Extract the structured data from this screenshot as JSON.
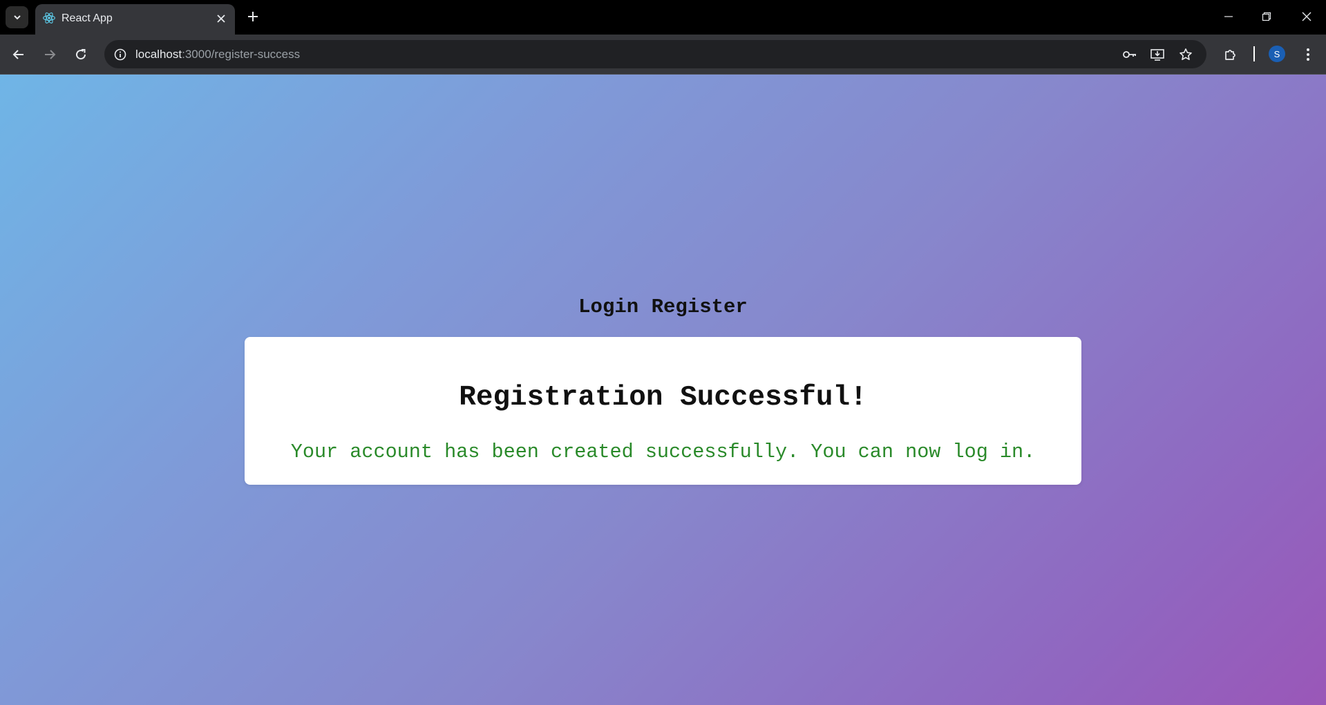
{
  "browser": {
    "tab": {
      "title": "React App",
      "favicon": "react-logo-icon"
    },
    "address_bar": {
      "host": "localhost",
      "path": ":3000/register-success"
    },
    "profile_initial": "S",
    "accent_color": "#1a5fb4"
  },
  "page": {
    "nav": {
      "login_label": "Login",
      "register_label": "Register"
    },
    "card": {
      "heading": "Registration Successful!",
      "message": "Your account has been created successfully. You can now log in.",
      "message_color": "#2a8a2a"
    }
  }
}
